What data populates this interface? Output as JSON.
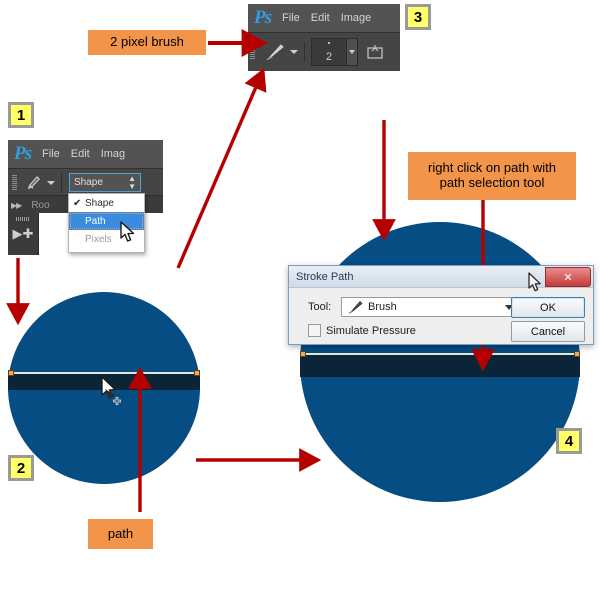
{
  "colors": {
    "arrow_red": "#b60000",
    "callout_orange": "#f2954a",
    "badge_yellow": "#ffff66",
    "circle_blue": "#064d83",
    "band_navy": "#0c2438",
    "ps_menubar": "#535353",
    "ps_optionbar": "#454545",
    "accent_blue": "#3a8ce0"
  },
  "badges": {
    "one": "1",
    "two": "2",
    "three": "3",
    "four": "4"
  },
  "callouts": {
    "brush": "2 pixel brush",
    "right_click": "right click on path with\npath selection tool",
    "right_click_line1": "right click on path with",
    "right_click_line2": "path selection tool",
    "path": "path"
  },
  "ps_window_1": {
    "logo": "Ps",
    "menu": [
      "File",
      "Edit",
      "Imag"
    ],
    "tool_icon": "pen-tool-icon",
    "mode_combo_value": "Shape",
    "document_tab": "Roo",
    "dropdown": {
      "options": [
        {
          "label": "Shape",
          "checked": true,
          "selected": false,
          "dimmed": false
        },
        {
          "label": "Path",
          "checked": false,
          "selected": true,
          "dimmed": false
        },
        {
          "label": "Pixels",
          "checked": false,
          "selected": false,
          "dimmed": true
        }
      ],
      "check_glyph": "✔"
    }
  },
  "ps_window_3": {
    "logo": "Ps",
    "menu": [
      "File",
      "Edit",
      "Image"
    ],
    "tool_icon": "brush-tool-icon",
    "brush_size": "2",
    "panel_icon": "brush-panel-icon"
  },
  "dialog": {
    "title": "Stroke Path",
    "close_glyph": "✕",
    "tool_label": "Tool:",
    "tool_value": "Brush",
    "tool_icon": "brush-icon",
    "simulate_pressure_label": "Simulate Pressure",
    "simulate_pressure_checked": false,
    "ok_label": "OK",
    "cancel_label": "Cancel"
  },
  "canvas": {
    "left_circle_label": "blue circle with horizontal path",
    "right_circle_label": "blue circle with stroked path band"
  }
}
